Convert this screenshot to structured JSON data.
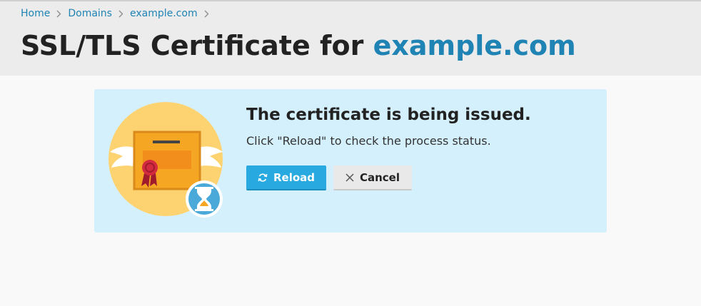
{
  "breadcrumb": {
    "items": [
      "Home",
      "Domains",
      "example.com"
    ]
  },
  "page": {
    "title_prefix": "SSL/TLS Certificate for ",
    "title_domain": "example.com"
  },
  "message": {
    "title": "The certificate is being issued.",
    "text": "Click \"Reload\" to check the process status."
  },
  "buttons": {
    "reload_label": "Reload",
    "cancel_label": "Cancel"
  },
  "icons": {
    "separator": "chevron-right-icon",
    "reload": "refresh-icon",
    "cancel": "close-icon",
    "illustration": "certificate-illustration",
    "status": "hourglass-icon"
  },
  "colors": {
    "link": "#1f83b4",
    "header_bg": "#ececec",
    "panel_bg": "#d5f0fd",
    "primary_button": "#28a9df",
    "secondary_button": "#e9e9e9"
  }
}
